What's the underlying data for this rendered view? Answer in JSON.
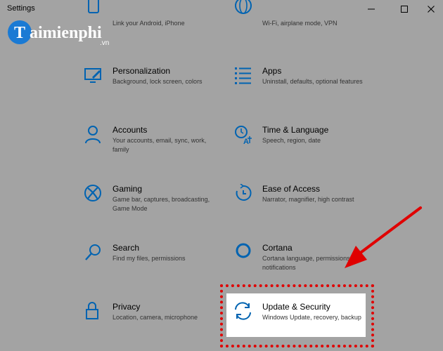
{
  "window": {
    "title": "Settings",
    "controls": {
      "minimize": "minimize",
      "maximize": "maximize",
      "close": "close"
    }
  },
  "watermark": {
    "brand": "aimienphi",
    "initial": "T",
    "suffix": ".vn"
  },
  "tiles": [
    {
      "id": "phone",
      "desc": "Link your Android, iPhone",
      "icon": "phone-icon"
    },
    {
      "id": "network",
      "desc": "Wi-Fi, airplane mode, VPN",
      "icon": "globe-icon"
    },
    {
      "id": "personalization",
      "title": "Personalization",
      "desc": "Background, lock screen, colors",
      "icon": "paintbrush-screen-icon"
    },
    {
      "id": "apps",
      "title": "Apps",
      "desc": "Uninstall, defaults, optional features",
      "icon": "apps-list-icon"
    },
    {
      "id": "accounts",
      "title": "Accounts",
      "desc": "Your accounts, email, sync, work, family",
      "icon": "person-icon"
    },
    {
      "id": "time-language",
      "title": "Time & Language",
      "desc": "Speech, region, date",
      "icon": "clock-language-icon"
    },
    {
      "id": "gaming",
      "title": "Gaming",
      "desc": "Game bar, captures, broadcasting, Game Mode",
      "icon": "xbox-icon"
    },
    {
      "id": "ease-of-access",
      "title": "Ease of Access",
      "desc": "Narrator, magnifier, high contrast",
      "icon": "ease-of-access-icon"
    },
    {
      "id": "search",
      "title": "Search",
      "desc": "Find my files, permissions",
      "icon": "magnifier-icon"
    },
    {
      "id": "cortana",
      "title": "Cortana",
      "desc": "Cortana language, permissions, notifications",
      "icon": "cortana-ring-icon"
    },
    {
      "id": "privacy",
      "title": "Privacy",
      "desc": "Location, camera, microphone",
      "icon": "lock-icon"
    },
    {
      "id": "update-security",
      "title": "Update & Security",
      "desc": "Windows Update, recovery, backup",
      "icon": "sync-arrows-icon"
    }
  ],
  "colors": {
    "accent": "#0063b1",
    "annotation": "#e00000",
    "overlay": "#a3a3a3"
  }
}
